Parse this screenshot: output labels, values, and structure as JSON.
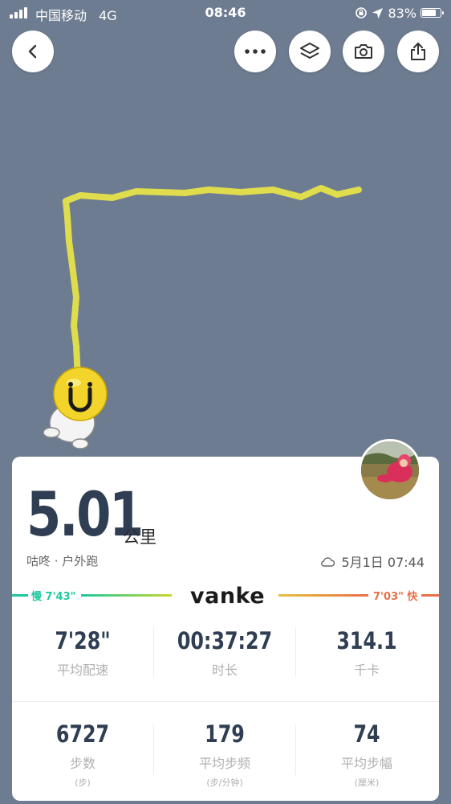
{
  "status_bar": {
    "carrier": "中国移动",
    "network": "4G",
    "time": "08:46",
    "battery_percent": "83%",
    "battery_level": 0.83
  },
  "toolbar": {
    "back_icon": "chevron-left-icon",
    "more_icon": "more-dots-icon",
    "layers_icon": "layers-icon",
    "camera_icon": "camera-icon",
    "share_icon": "share-icon"
  },
  "summary": {
    "distance": "5.01",
    "distance_unit": "公里",
    "run_type": "咕咚 · 户外跑",
    "weather_icon": "cloud-icon",
    "datetime": "5月1日 07:44"
  },
  "pace_legend": {
    "slow_label": "慢 7'43\"",
    "fast_label": "7'03\" 快",
    "brand": "vanke",
    "slow_color": "#1ec9a0",
    "mid_color": "#c8d630",
    "fast_color": "#e8704a"
  },
  "stats": [
    {
      "value": "7'28\"",
      "label": "平均配速",
      "sub": ""
    },
    {
      "value": "00:37:27",
      "label": "时长",
      "sub": ""
    },
    {
      "value": "314.1",
      "label": "千卡",
      "sub": ""
    },
    {
      "value": "6727",
      "label": "步数",
      "sub": "(步)"
    },
    {
      "value": "179",
      "label": "平均步频",
      "sub": "(步/分钟)"
    },
    {
      "value": "74",
      "label": "平均步幅",
      "sub": "(厘米)"
    }
  ],
  "colors": {
    "map_background": "#6e7c91",
    "route": "#e6e34a",
    "number": "#2f3e52"
  }
}
